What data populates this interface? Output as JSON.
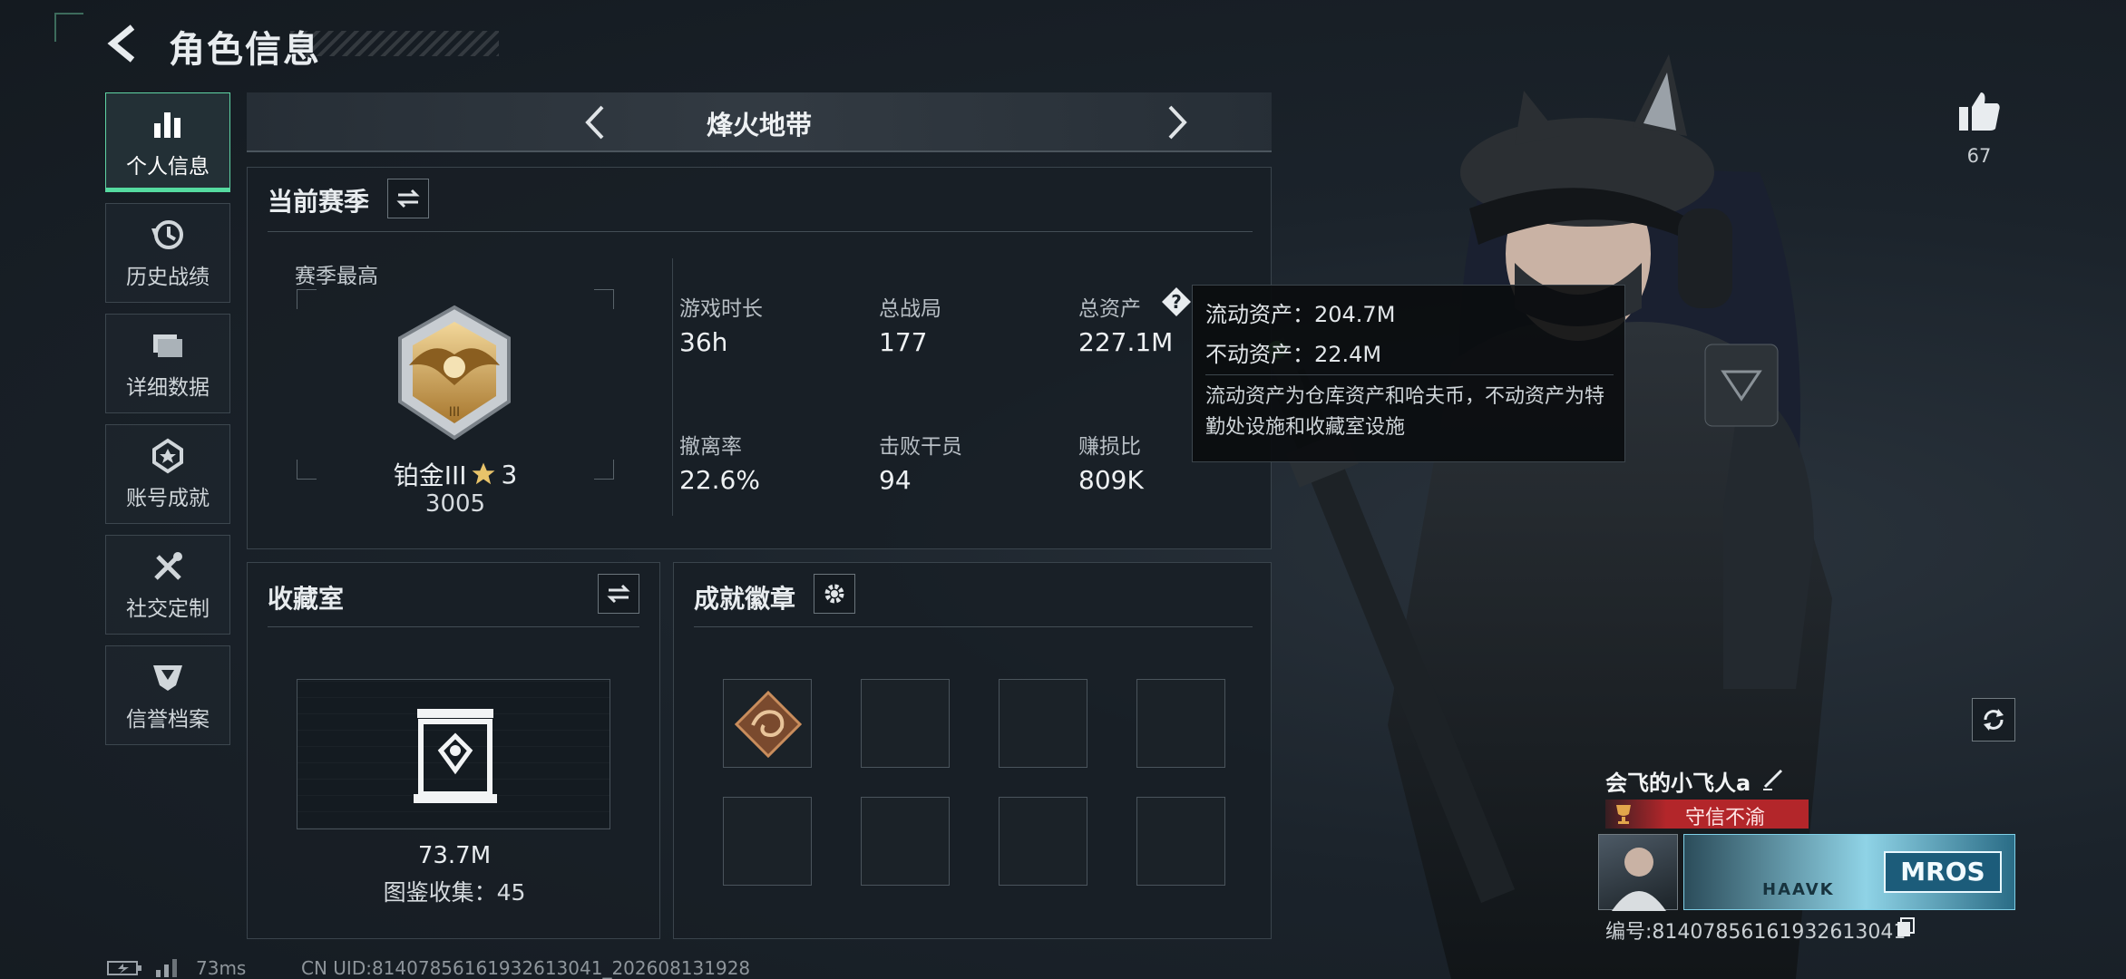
{
  "header": {
    "title": "角色信息"
  },
  "sidebar": {
    "items": [
      {
        "label": "个人信息",
        "icon": "bar-chart-icon",
        "active": true
      },
      {
        "label": "历史战绩",
        "icon": "clock-history-icon",
        "active": false
      },
      {
        "label": "详细数据",
        "icon": "folder-icon",
        "active": false
      },
      {
        "label": "账号成就",
        "icon": "achievement-medal-icon",
        "active": false
      },
      {
        "label": "社交定制",
        "icon": "tools-icon",
        "active": false
      },
      {
        "label": "信誉档案",
        "icon": "shield-badge-icon",
        "active": false
      }
    ]
  },
  "mode_selector": {
    "title": "烽火地带"
  },
  "season": {
    "title": "当前赛季",
    "best_label": "赛季最高",
    "rank_name": "铂金III",
    "rank_stars": "3",
    "rank_points": "3005",
    "stats": [
      {
        "label": "游戏时长",
        "value": "36h"
      },
      {
        "label": "总战局",
        "value": "177"
      },
      {
        "label": "总资产",
        "value": "227.1M"
      },
      {
        "label": "撤离率",
        "value": "22.6%"
      },
      {
        "label": "击败干员",
        "value": "94"
      },
      {
        "label": "赚损比",
        "value": "809K"
      }
    ]
  },
  "tooltip": {
    "liquid": "流动资产：204.7M",
    "fixed": "不动资产：22.4M",
    "description": "流动资产为仓库资产和哈夫币，不动资产为特勤处设施和收藏室设施"
  },
  "collection": {
    "title": "收藏室",
    "value": "73.7M",
    "catalog": "图鉴收集：45"
  },
  "badges": {
    "title": "成就徽章",
    "slots": 8,
    "filled": 1
  },
  "profile": {
    "likes": "67",
    "nickname": "会飞的小飞人a",
    "title_tag": "守信不渝",
    "banner_text": "MROS",
    "banner_subtext": "HAAVK",
    "id_line": "编号:8140785616193261304​1"
  },
  "status_bar": {
    "ping": "73ms",
    "uid": "CN UID:8140785616193261304​1_202608131928"
  },
  "colors": {
    "accent": "#55dba0",
    "title_tag_bg": "#b3262a",
    "panel_border": "#3a444c"
  }
}
